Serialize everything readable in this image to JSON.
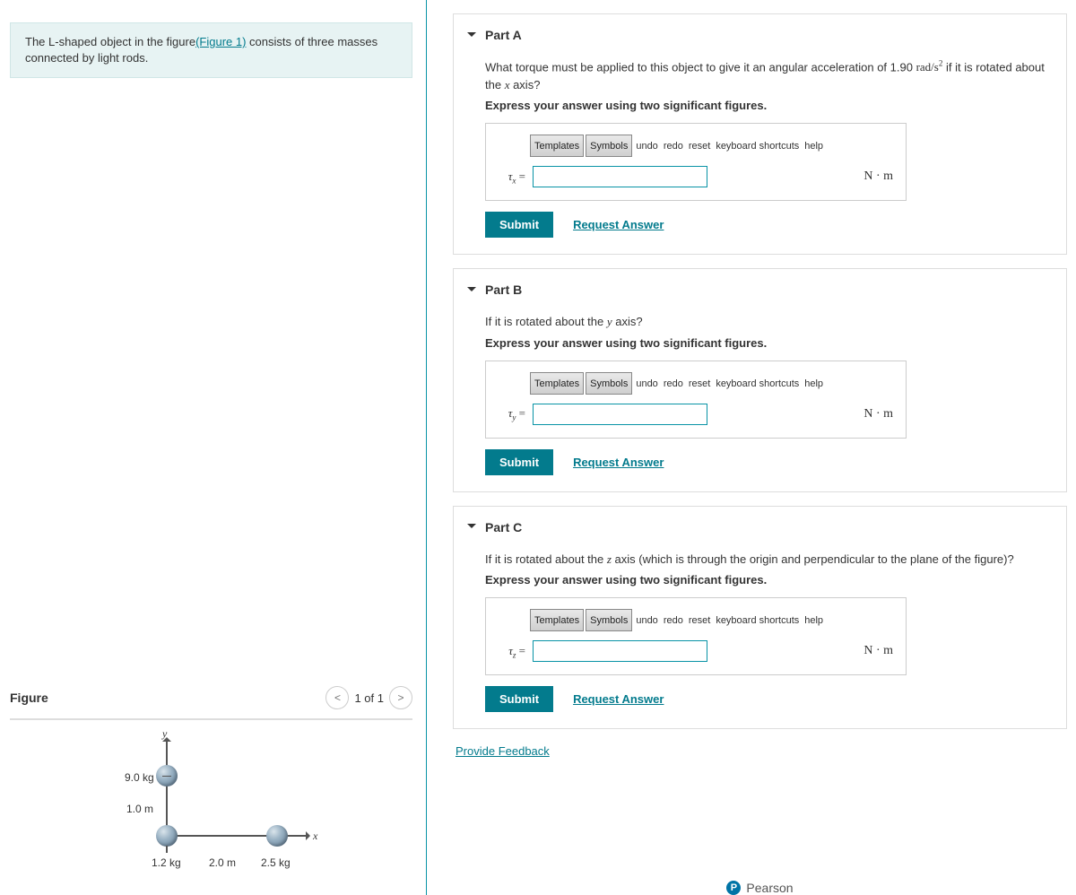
{
  "intro": {
    "text_before": "The L-shaped object in the figure",
    "link_text": "(Figure 1)",
    "text_after": " consists of three masses connected by light rods."
  },
  "figure": {
    "title": "Figure",
    "pager": "1 of 1",
    "y_label": "y",
    "x_label": "x",
    "mass_top_label": "9.0 kg",
    "mass_top_dist": "1.0 m",
    "mass_origin_label": "1.2 kg",
    "mass_right_dist": "2.0 m",
    "mass_right_label": "2.5 kg"
  },
  "toolbar": {
    "templates": "Templates",
    "symbols": "Symbols",
    "undo": "undo",
    "redo": "redo",
    "reset": "reset",
    "keyboard": "keyboard shortcuts",
    "help": "help"
  },
  "common": {
    "submit": "Submit",
    "request": "Request Answer",
    "unit": "N · m",
    "instruct": "Express your answer using two significant figures."
  },
  "parts": {
    "a": {
      "header": "Part A",
      "q1": "What torque must be applied to this object to give it an angular acceleration of 1.90 ",
      "q_unit": "rad/s",
      "q2": " if it is rotated about the ",
      "axis": "x",
      "q3": " axis?",
      "prefix": "τx ="
    },
    "b": {
      "header": "Part B",
      "q1": "If it is rotated about the ",
      "axis": "y",
      "q2": " axis?",
      "prefix": "τy ="
    },
    "c": {
      "header": "Part C",
      "q1": "If it is rotated about the ",
      "axis": "z",
      "q2": " axis (which is through the origin and perpendicular to the plane of the figure)?",
      "prefix": "τz ="
    }
  },
  "feedback": "Provide Feedback",
  "brand": "Pearson",
  "chart_data": {
    "type": "diagram",
    "description": "L-shaped rigid body of three point masses connected by light rods along the x and y axes",
    "masses": [
      {
        "name": "top",
        "mass_kg": 9.0,
        "x_m": 0.0,
        "y_m": 1.0
      },
      {
        "name": "origin",
        "mass_kg": 1.2,
        "x_m": 0.0,
        "y_m": 0.0
      },
      {
        "name": "right",
        "mass_kg": 2.5,
        "x_m": 2.0,
        "y_m": 0.0
      }
    ],
    "angular_acceleration_rad_s2": 1.9
  }
}
